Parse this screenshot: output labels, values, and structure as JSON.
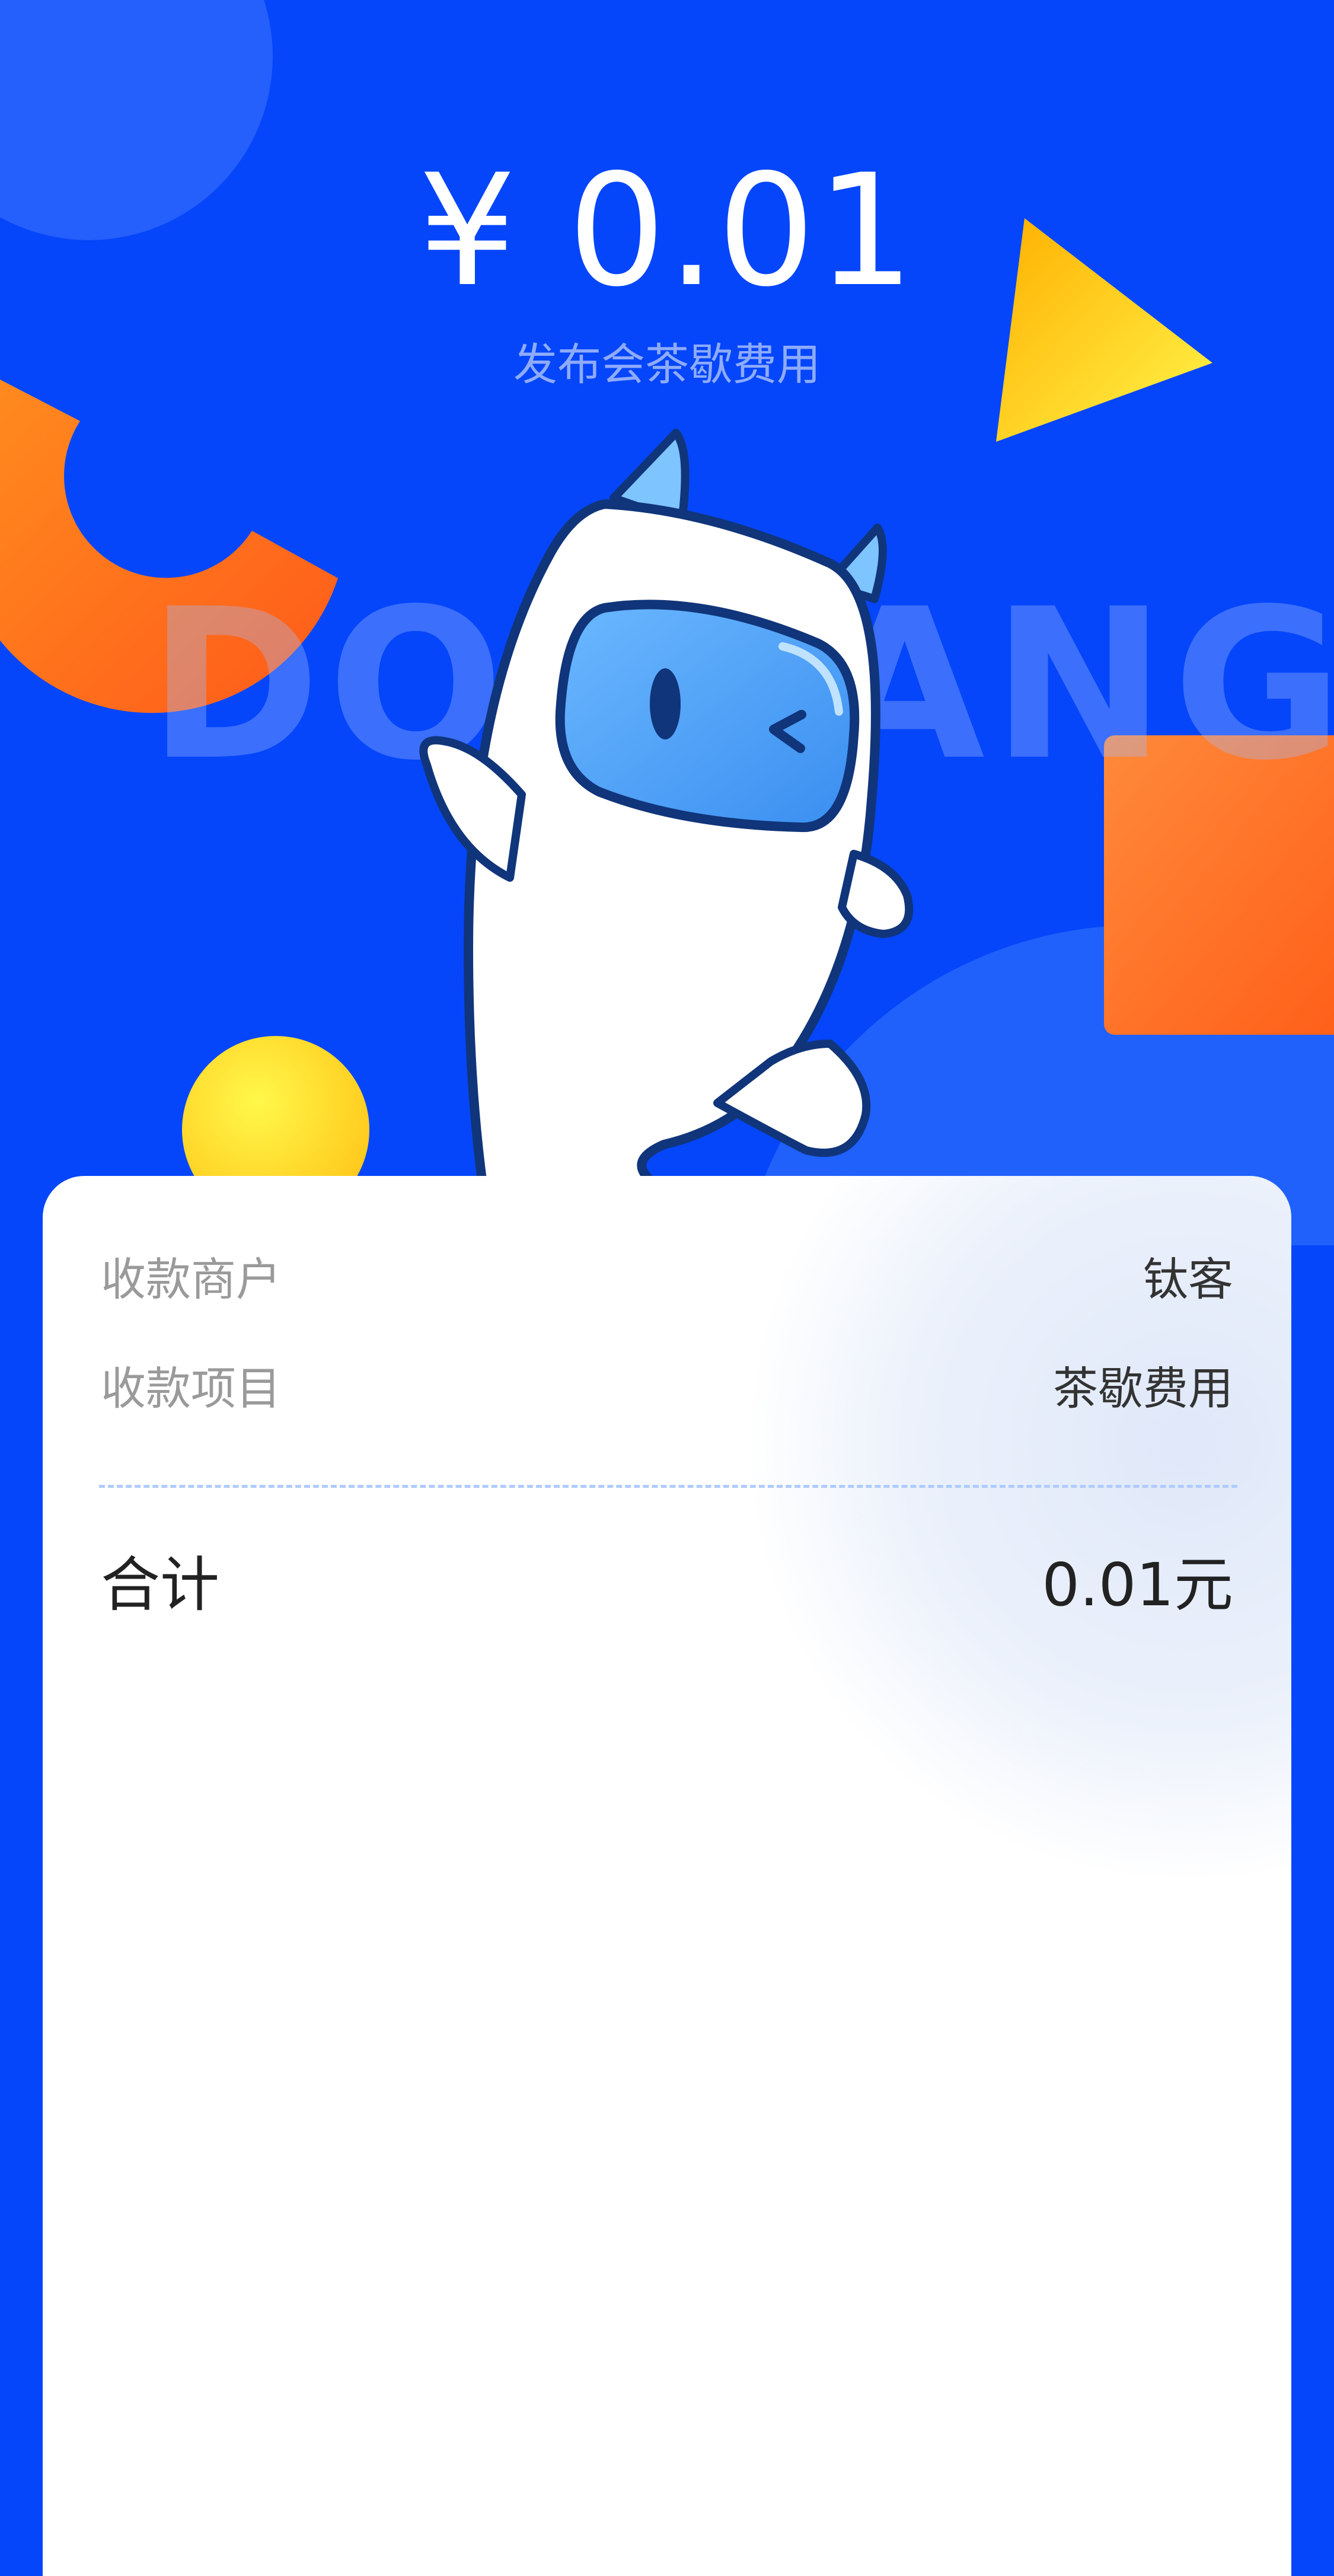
{
  "header": {
    "amount": "¥ 0.01",
    "subtitle": "发布会茶歇费用",
    "watermark": "DOUYANG"
  },
  "details": {
    "merchant_label": "收款商户",
    "merchant_value": "钛客",
    "item_label": "收款项目",
    "item_value": "茶歇费用",
    "total_label": "合计",
    "total_value": "0.01元"
  },
  "colors": {
    "background_blue": "#0546FA",
    "card": "#FFFFFF",
    "accent_orange": "#FF6A1A",
    "accent_yellow": "#FFE12E",
    "divider": "#AFCBFF"
  }
}
